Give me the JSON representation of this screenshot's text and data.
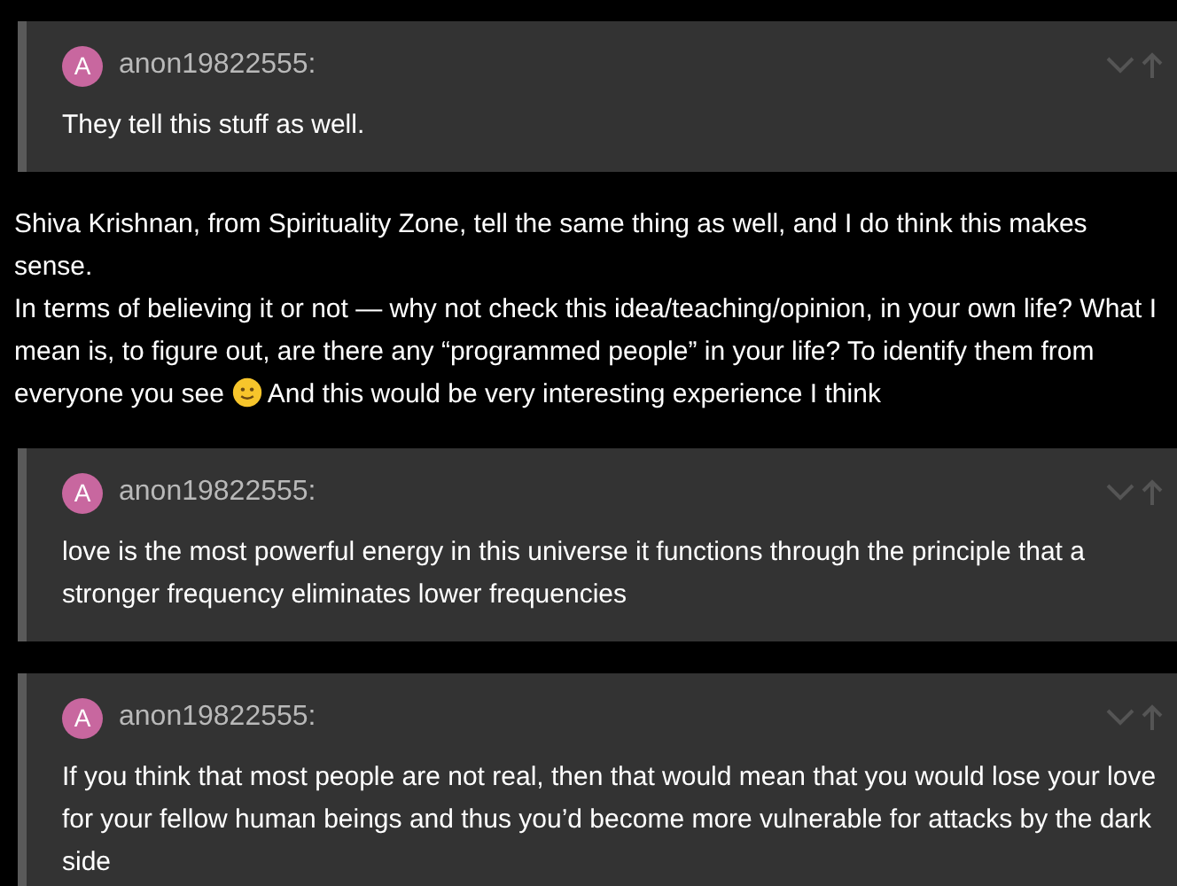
{
  "blocks": [
    {
      "kind": "quote",
      "avatar": "A",
      "username": "anon19822555:",
      "text": "They tell this stuff as well."
    },
    {
      "kind": "post",
      "paragraphs": [
        {
          "parts": [
            {
              "kind": "text",
              "text": "Shiva Krishnan, from Spirituality Zone, tell the same thing as well, and I do think this makes sense."
            }
          ]
        },
        {
          "parts": [
            {
              "kind": "text",
              "text": "In terms of believing it or not — why not check this idea/teaching/opinion, in your own life? What I mean is, to figure out, are there any “programmed people” in your life? To identify them from everyone you see "
            },
            {
              "kind": "emoji"
            },
            {
              "kind": "text",
              "text": " And this would be very interesting experience I think"
            }
          ]
        }
      ]
    },
    {
      "kind": "quote",
      "avatar": "A",
      "username": "anon19822555:",
      "text": "love is the most powerful energy in this universe it functions through the principle that a stronger frequency eliminates lower frequencies"
    },
    {
      "kind": "quote",
      "avatar": "A",
      "username": "anon19822555:",
      "text": "If you think that most people are not real, then that would mean that you would lose your love for your fellow human beings and thus you’d become more vulnerable for attacks by the dark side"
    }
  ]
}
